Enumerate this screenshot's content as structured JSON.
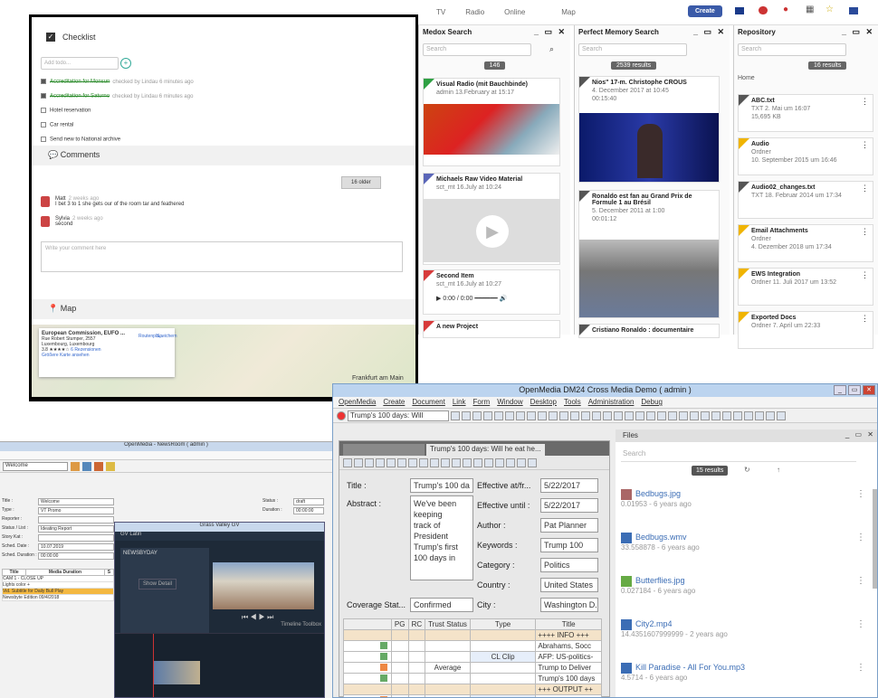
{
  "topnav": {
    "items": [
      "TV",
      "Radio",
      "Online",
      "Map"
    ],
    "create_label": "Create"
  },
  "medox": {
    "title": "Medox Search",
    "search_placeholder": "Search",
    "count": "146",
    "cards": [
      {
        "title": "Visual Radio (mit Bauchbinde)",
        "meta": "admin  13.February at 15:17",
        "color": "#2ea043"
      },
      {
        "title": "Michaels Raw Video Material",
        "meta": "sct_mt  16.July at 10:24",
        "color": "#5a66b8"
      },
      {
        "title": "Second Item",
        "meta": "sct_mt  16.July at 10:27",
        "color": "#d73a3a",
        "audio": "0:00 / 0:00"
      },
      {
        "title": "A new Project",
        "meta": "",
        "color": "#d73a3a"
      }
    ]
  },
  "pm": {
    "title": "Perfect Memory Search",
    "search_placeholder": "Search",
    "count": "2539 results",
    "cards": [
      {
        "title": "Nios\" 17-m. Christophe CROUS",
        "meta": "4. December 2017 at 10:45",
        "dur": "00:15:40"
      },
      {
        "title": "Ronaldo est fan au Grand Prix de Formule 1 au Brésil",
        "meta": "5. December 2011 at 1:00",
        "dur": "00:01:12"
      },
      {
        "title": "Cristiano Ronaldo : documentaire",
        "meta": "",
        "dur": ""
      }
    ]
  },
  "repo": {
    "title": "Repository",
    "search_placeholder": "Search",
    "count": "16 results",
    "crumb": "Home",
    "items": [
      {
        "title": "ABC.txt",
        "meta": "TXT    2. Mai um 16:07",
        "sub": "15,695 KB",
        "color": "#555"
      },
      {
        "title": "Audio",
        "meta": "Ordner",
        "sub": "10. September 2015 um 16:46",
        "color": "#f0b400"
      },
      {
        "title": "Audio02_changes.txt",
        "meta": "TXT    18. Februar 2014 um 17:34",
        "sub": "",
        "color": "#555"
      },
      {
        "title": "Email Attachments",
        "meta": "Ordner",
        "sub": "4. Dezember 2018 um 17:34",
        "color": "#f0b400"
      },
      {
        "title": "EWS Integration",
        "meta": "Ordner   11. Juli 2017 um 13:52",
        "sub": "",
        "color": "#f0b400"
      },
      {
        "title": "Exported Docs",
        "meta": "Ordner   7. April um 22:33",
        "sub": "",
        "color": "#f0b400"
      }
    ]
  },
  "checklist": {
    "title": "Checklist",
    "add_placeholder": "Add todo...",
    "items": [
      {
        "text": "Accreditation for Monsun",
        "note": "checked by Lindau 6 minutes ago",
        "done": true
      },
      {
        "text": "Accreditation for Saturno",
        "note": "checked by Lindau 6 minutes ago",
        "done": true
      },
      {
        "text": "Hotel reservation",
        "note": "",
        "done": false
      },
      {
        "text": "Car rental",
        "note": "",
        "done": false
      },
      {
        "text": "Send new to National archive",
        "note": "",
        "done": false
      }
    ]
  },
  "comments": {
    "title": "Comments",
    "older_label": "16 older",
    "items": [
      {
        "author": "Matt",
        "when": "2 weeks ago",
        "text": "I bet 3 to 1 she gets our of the room tar and feathered"
      },
      {
        "author": "Sylvia",
        "when": "2 weeks ago",
        "text": "second"
      }
    ],
    "input_placeholder": "Write your comment here"
  },
  "map": {
    "title": "Map",
    "place": "European Commission, EUFO ...",
    "addr1": "Rue Robert Stumper, 2557",
    "addr2": "Luxembourg, Luxembourg",
    "rating": "3.8",
    "reviews": "6 Rezensionen",
    "link": "Größere Karte ansehen",
    "route": "Routenpla...",
    "save": "Speichern",
    "city": "Frankfurt am Main"
  },
  "om": {
    "title": "OpenMedia    DM24 Cross Media Demo ( admin )",
    "menu": [
      "OpenMedia",
      "Create",
      "Document",
      "Link",
      "Form",
      "Window",
      "Desktop",
      "Tools",
      "Administration",
      "Debug"
    ],
    "toolbar_combo": "Trump's 100 days: Will",
    "tabs": [
      "Trump's 100 days: Will he eat he..."
    ],
    "fields": {
      "title_label": "Title :",
      "title": "Trump's 100 da",
      "abstract_label": "Abstract :",
      "abstract": "We've been keeping track of President Trump's first 100 days in",
      "eff_from_label": "Effective at/fr...",
      "eff_from": "5/22/2017",
      "eff_until_label": "Effective until :",
      "eff_until": "5/22/2017",
      "author_label": "Author :",
      "author": "Pat Planner",
      "keywords_label": "Keywords :",
      "keywords": "Trump 100",
      "category_label": "Category :",
      "category": "Politics",
      "country_label": "Country :",
      "country": "United States",
      "city_label": "City :",
      "city": "Washington D.C",
      "coverage_label": "Coverage Stat...",
      "coverage": "Confirmed"
    },
    "grid_headers": [
      "",
      "PG",
      "RC",
      "Trust Status",
      "Type",
      "Title"
    ],
    "grid_rows": [
      {
        "ts": "",
        "type": "",
        "title": "++++ INFO +++",
        "hl": true
      },
      {
        "ts": "",
        "type": "",
        "title": "Abrahams, Socc",
        "hl": false
      },
      {
        "ts": "",
        "type": "CL Clip",
        "title": "AFP: US-politics-",
        "hl": false
      },
      {
        "ts": "Average",
        "type": "",
        "title": "Trump to Deliver",
        "hl": false
      },
      {
        "ts": "",
        "type": "",
        "title": "Trump's 100 days",
        "hl": false
      },
      {
        "ts": "",
        "type": "",
        "title": "+++ OUTPUT ++",
        "hl": true
      },
      {
        "ts": "",
        "type": "CMS post",
        "title": "Trump's 100 days",
        "hl": false
      }
    ],
    "files": {
      "title": "Files",
      "search_placeholder": "Search",
      "count": "15 results",
      "items": [
        {
          "name": "Bedbugs.jpg",
          "meta": "0.01953 - 6 years ago"
        },
        {
          "name": "Bedbugs.wmv",
          "meta": "33.558878 - 6 years ago"
        },
        {
          "name": "Butterflies.jpg",
          "meta": "0.027184 - 6 years ago"
        },
        {
          "name": "City2.mp4",
          "meta": "14.4351607999999 - 2 years ago"
        },
        {
          "name": "Kill Paradise - All For You.mp3",
          "meta": "4.5714 - 6 years ago"
        }
      ]
    }
  },
  "newsroom": {
    "title": "OpenMedia - NewsRoom ( admin )",
    "combo": "Welcome",
    "labels": [
      "Title :",
      "Type :",
      "Reporter :",
      "Status / List :",
      "Story Kat :",
      "Sched. Date :",
      "Sched. Duration :"
    ],
    "values": [
      "Welcome",
      "VT Promo",
      "",
      "Ideating Report",
      "",
      "10.07.2019",
      "00:00:00"
    ],
    "right_labels": [
      "Status :",
      "Duration :"
    ],
    "right_values": [
      "draft",
      "00:00:00"
    ],
    "list_headers": [
      "Title",
      "Media Duration",
      "S"
    ],
    "list_rows": [
      "CAM 1 - CLOSE UP",
      "Lights color +",
      "Vid. Subtitle for Daily Bull Play",
      "Newsbyte Edition 09/4/2018"
    ]
  },
  "gv": {
    "title": "Grass Valley GV",
    "proj": "GV Latin",
    "tag": "NEWSBYDAY",
    "btn": "Show Detail",
    "tools": "Timeline  Toolbox"
  }
}
